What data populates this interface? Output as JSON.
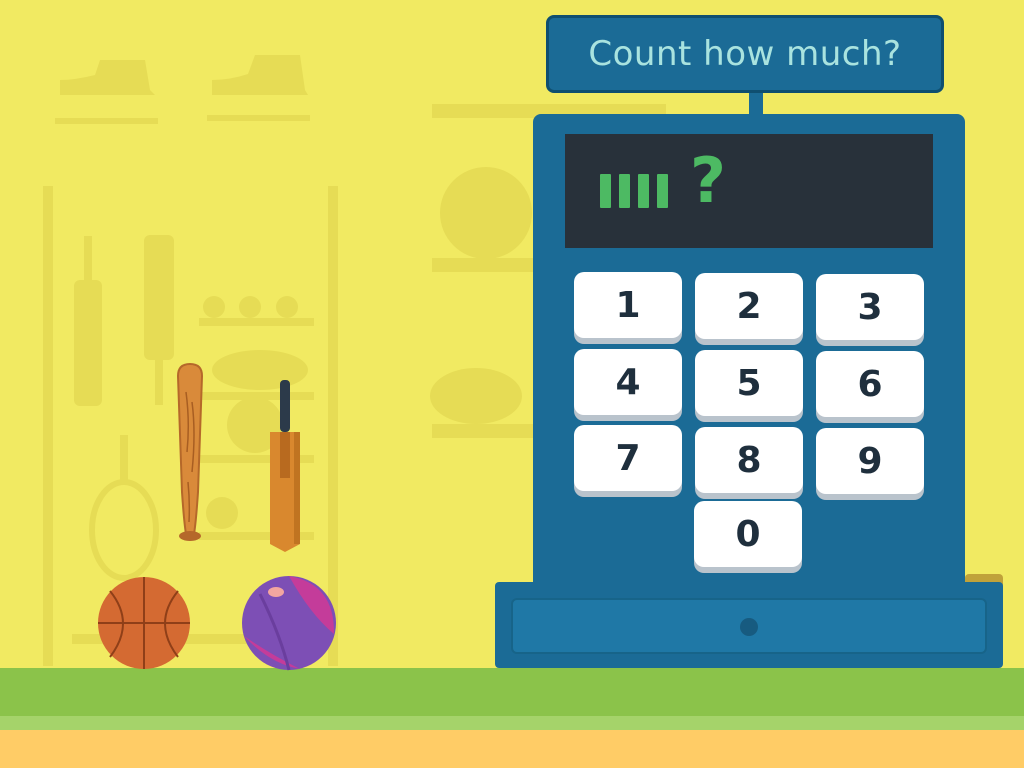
{
  "prompt": {
    "text": "Count how much?"
  },
  "display": {
    "tally_marks": 4,
    "unknown": "?"
  },
  "keypad": {
    "keys": [
      "1",
      "2",
      "3",
      "4",
      "5",
      "6",
      "7",
      "8",
      "9",
      "0"
    ]
  },
  "items": [
    {
      "name": "baseball-bat-icon"
    },
    {
      "name": "cricket-bat-icon"
    },
    {
      "name": "basketball-icon"
    },
    {
      "name": "beach-ball-icon"
    }
  ],
  "colors": {
    "background": "#f1ea62",
    "register": "#1b6b96",
    "screen": "#28313a",
    "tally": "#4dba63",
    "sign_text": "#a9e3df",
    "grass": "#8bc34a",
    "sand": "#ffcc66"
  }
}
